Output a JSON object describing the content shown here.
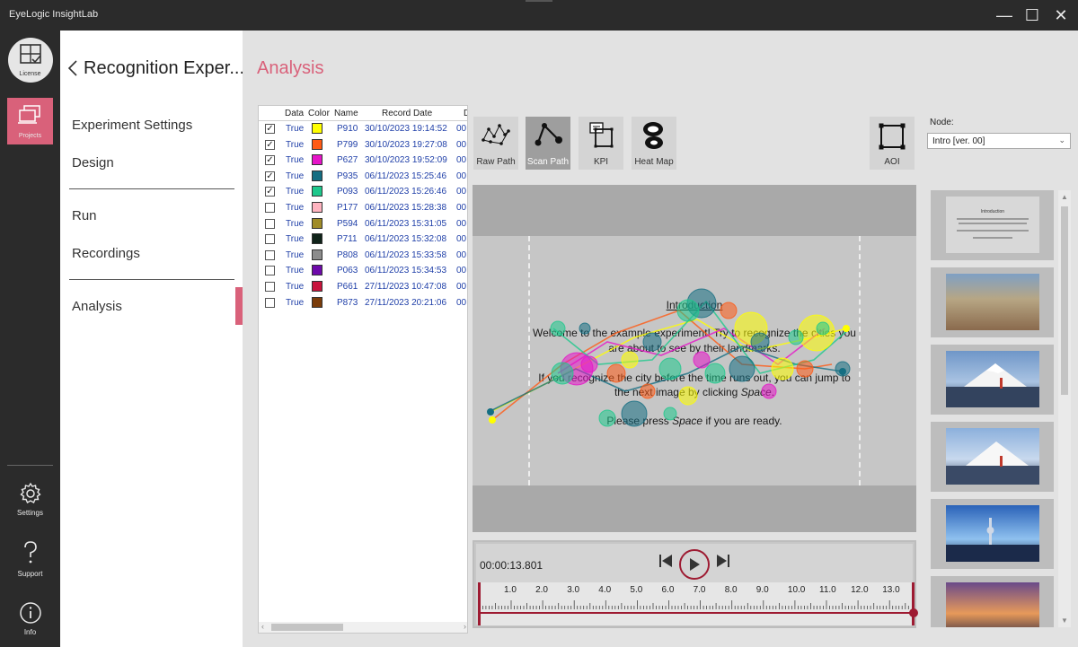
{
  "app": {
    "title": "EyeLogic InsightLab",
    "window_controls": {
      "minimize": "—",
      "maximize": "☐",
      "close": "✕"
    }
  },
  "rail": {
    "license": "License",
    "projects": "Projects",
    "settings": "Settings",
    "support": "Support",
    "info": "Info"
  },
  "sidebar": {
    "project_title": "Recognition Exper...",
    "items": [
      "Experiment Settings",
      "Design",
      "Run",
      "Recordings",
      "Analysis"
    ],
    "active": "Analysis"
  },
  "main": {
    "title": "Analysis"
  },
  "table": {
    "columns": [
      "Data",
      "Color",
      "Name",
      "Record Date",
      "D"
    ],
    "rows": [
      {
        "checked": true,
        "data": "True",
        "color": "#ffff00",
        "name": "P910",
        "date": "30/10/2023 19:14:52",
        "extra": "00:"
      },
      {
        "checked": true,
        "data": "True",
        "color": "#ff5a14",
        "name": "P799",
        "date": "30/10/2023 19:27:08",
        "extra": "00:"
      },
      {
        "checked": true,
        "data": "True",
        "color": "#e614c8",
        "name": "P627",
        "date": "30/10/2023 19:52:09",
        "extra": "00:"
      },
      {
        "checked": true,
        "data": "True",
        "color": "#146e82",
        "name": "P935",
        "date": "06/11/2023 15:25:46",
        "extra": "00:"
      },
      {
        "checked": true,
        "data": "True",
        "color": "#1ec88c",
        "name": "P093",
        "date": "06/11/2023 15:26:46",
        "extra": "00:"
      },
      {
        "checked": false,
        "data": "True",
        "color": "#ffb4c0",
        "name": "P177",
        "date": "06/11/2023 15:28:38",
        "extra": "00:"
      },
      {
        "checked": false,
        "data": "True",
        "color": "#a08c28",
        "name": "P594",
        "date": "06/11/2023 15:31:05",
        "extra": "00:"
      },
      {
        "checked": false,
        "data": "True",
        "color": "#0f2319",
        "name": "P711",
        "date": "06/11/2023 15:32:08",
        "extra": "00:"
      },
      {
        "checked": false,
        "data": "True",
        "color": "#8c8c8c",
        "name": "P808",
        "date": "06/11/2023 15:33:58",
        "extra": "00:"
      },
      {
        "checked": false,
        "data": "True",
        "color": "#6e0aaa",
        "name": "P063",
        "date": "06/11/2023 15:34:53",
        "extra": "00:"
      },
      {
        "checked": false,
        "data": "True",
        "color": "#c8143c",
        "name": "P661",
        "date": "27/11/2023 10:47:08",
        "extra": "00:"
      },
      {
        "checked": false,
        "data": "True",
        "color": "#7a3c0a",
        "name": "P873",
        "date": "27/11/2023 20:21:06",
        "extra": "00:"
      }
    ]
  },
  "toolbar": {
    "raw_path": "Raw Path",
    "scan_path": "Scan Path",
    "kpi": "KPI",
    "heat_map": "Heat Map",
    "aoi": "AOI",
    "active": "Scan Path"
  },
  "node": {
    "label": "Node:",
    "selected": "Intro [ver. 00]"
  },
  "stimulus": {
    "heading": "Introduction",
    "line1": "Welcome to the example experiment! Try to recognize the cities you",
    "line2": "are about to see by their landmarks.",
    "line3": "If you recognize the city before the time runs out, you can jump to",
    "line4a": "the next image by clicking ",
    "line4b": "Space",
    "line5a": "Please press ",
    "line5b": "Space",
    "line5c": " if you are ready."
  },
  "player": {
    "time": "00:00:13.801",
    "ticks": [
      "1.0",
      "2.0",
      "3.0",
      "4.0",
      "5.0",
      "6.0",
      "7.0",
      "8.0",
      "9.0",
      "10.0",
      "11.0",
      "12.0",
      "13.0"
    ]
  },
  "thumbnails": [
    {
      "kind": "text-slide",
      "title": "Introduction"
    },
    {
      "kind": "city",
      "palette": [
        "#5d7fa8",
        "#c9b79a",
        "#8a6a4d"
      ]
    },
    {
      "kind": "mountain",
      "palette": [
        "#7ea2cf",
        "#ffffff",
        "#2c3e5c"
      ]
    },
    {
      "kind": "mountain",
      "palette": [
        "#9ab8df",
        "#f5f5f5",
        "#33435e"
      ]
    },
    {
      "kind": "skyline-blue",
      "palette": [
        "#2a62b8",
        "#8fc1ef",
        "#1b2a4a"
      ]
    },
    {
      "kind": "skyline-dusk",
      "palette": [
        "#6a4a8a",
        "#e79a5a",
        "#2a2540"
      ]
    }
  ]
}
